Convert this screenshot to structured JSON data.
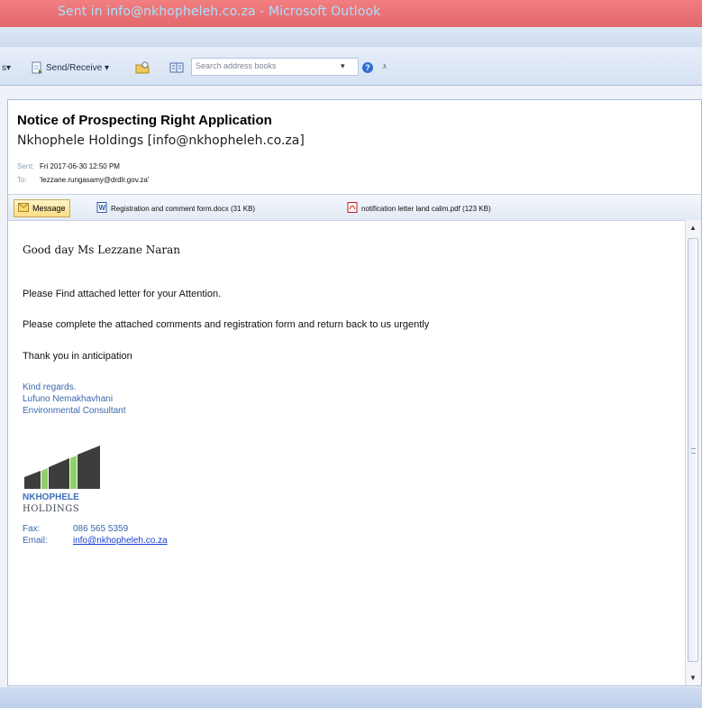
{
  "window": {
    "title": "Sent in info@nkhopheleh.co.za - Microsoft Outlook"
  },
  "toolbar": {
    "left_fragment": "s▾",
    "send_receive_label": "Send/Receive ▾",
    "search_placeholder": "Search address books",
    "search_dropdown": "▾",
    "help_glyph": "?",
    "overflow_glyph": "⩡"
  },
  "message": {
    "subject": "Notice of Prospecting Right Application",
    "from": "Nkhophele Holdings [info@nkhopheleh.co.za]",
    "sent_label": "Sent:",
    "sent_value": "Fri 2017-06-30 12:50 PM",
    "to_label": "To:",
    "to_value": "'lezzane.rungasamy@drdlr.gov.za'",
    "message_tab": "Message",
    "attachments": [
      {
        "name": "Registration and comment form.docx (31 KB)",
        "icon": "word-doc-icon"
      },
      {
        "name": "notification letter land calim.pdf (123 KB)",
        "icon": "pdf-icon"
      }
    ],
    "body": {
      "greeting": "Good day Ms Lezzane Naran",
      "line1": "Please Find attached letter for your Attention.",
      "line2": "Please complete the attached comments and registration form and return back to us urgently",
      "line3": "Thank you in anticipation",
      "regards": "Kind regards.",
      "name": "Lufuno Nemakhavhani",
      "role": "Environmental Consultant",
      "logo_line1": "NKHOPHELE",
      "logo_line2": "HOLDINGS",
      "fax_label": "Fax:",
      "fax_value": "086 565 5359",
      "email_label": "Email:",
      "email_value": "info@nkhopheleh.co.za"
    }
  },
  "colors": {
    "titlebar": "#e96e71",
    "title_text": "#a8e0ff",
    "signature_blue": "#3a67b0",
    "link_blue": "#1a3fd0",
    "logo_dark": "#3d3d3d",
    "logo_green": "#8fd06a"
  },
  "scrollbar": {
    "up_glyph": "▲",
    "down_glyph": "▼"
  }
}
